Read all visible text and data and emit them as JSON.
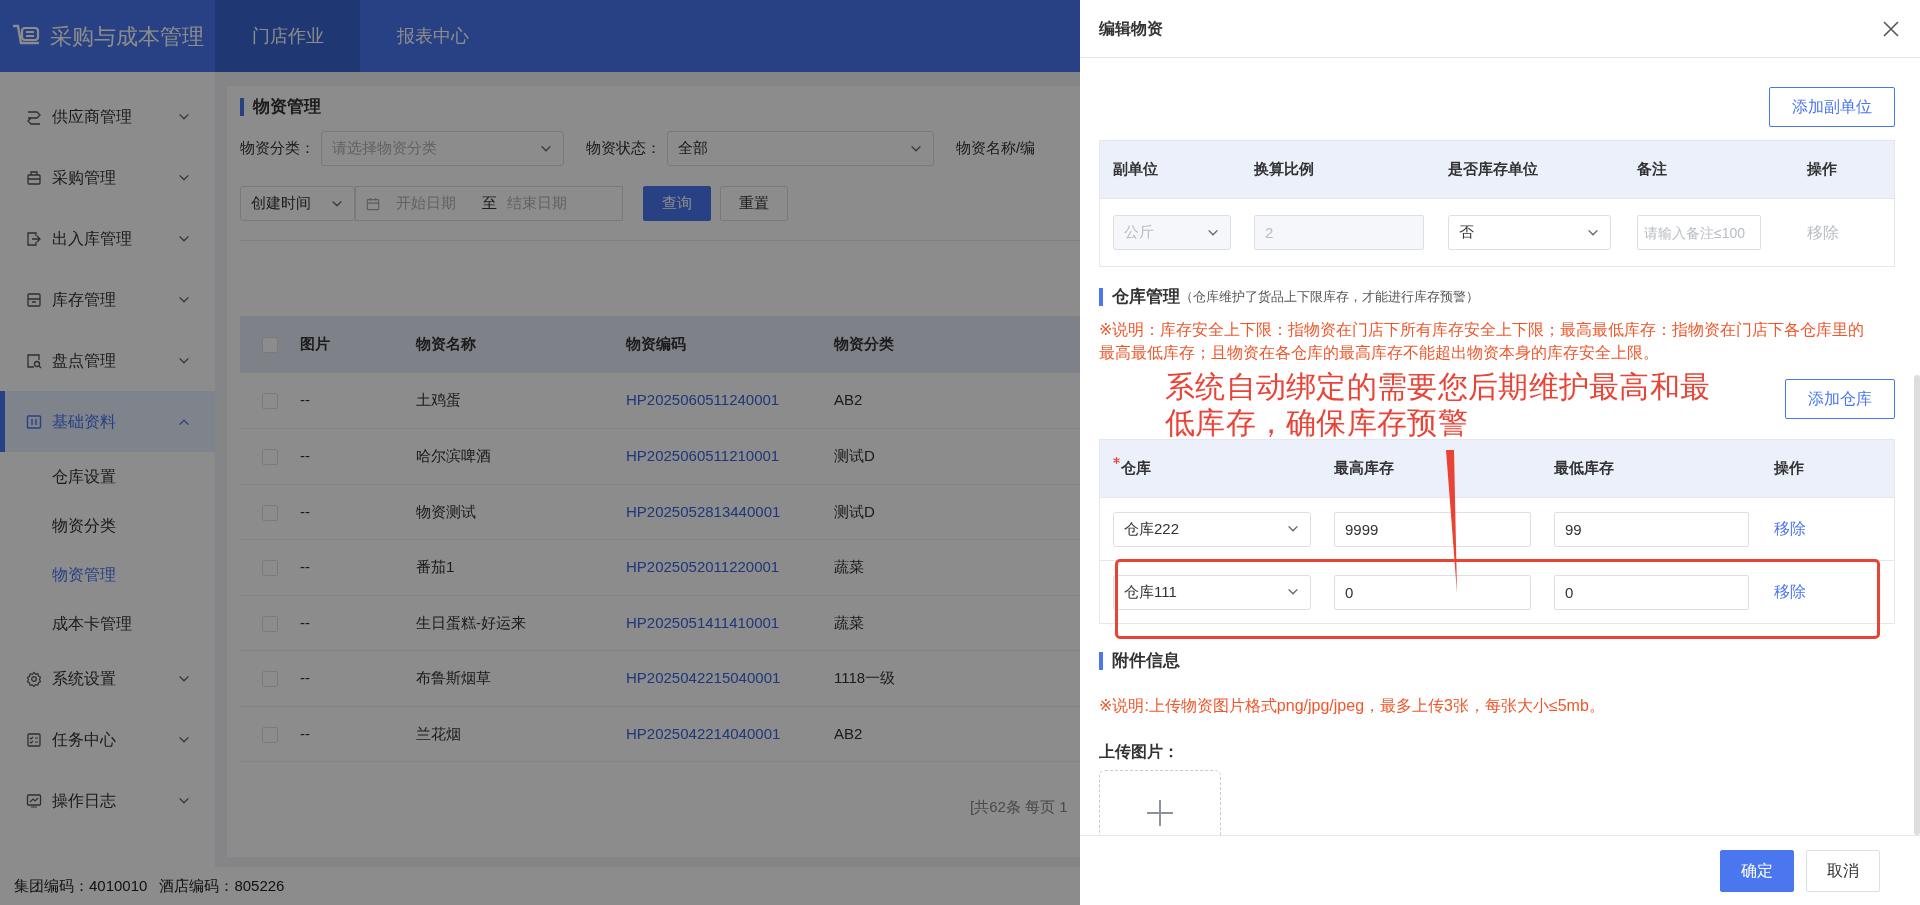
{
  "header": {
    "app_title": "采购与成本管理",
    "tabs": [
      {
        "label": "门店作业",
        "selected": true
      },
      {
        "label": "报表中心",
        "selected": false
      }
    ]
  },
  "sidebar": {
    "items": [
      {
        "label": "供应商管理",
        "expanded": false,
        "selected": false
      },
      {
        "label": "采购管理",
        "expanded": false,
        "selected": false
      },
      {
        "label": "出入库管理",
        "expanded": false,
        "selected": false
      },
      {
        "label": "库存管理",
        "expanded": false,
        "selected": false
      },
      {
        "label": "盘点管理",
        "expanded": false,
        "selected": false
      },
      {
        "label": "基础资料",
        "expanded": true,
        "selected": true,
        "children": [
          {
            "label": "仓库设置",
            "selected": false
          },
          {
            "label": "物资分类",
            "selected": false
          },
          {
            "label": "物资管理",
            "selected": true
          },
          {
            "label": "成本卡管理",
            "selected": false
          }
        ]
      },
      {
        "label": "系统设置",
        "expanded": false,
        "selected": false
      },
      {
        "label": "任务中心",
        "expanded": false,
        "selected": false
      },
      {
        "label": "操作日志",
        "expanded": false,
        "selected": false
      }
    ]
  },
  "page": {
    "title": "物资管理",
    "filters": [
      {
        "label": "物资分类：",
        "placeholder": "请选择物资分类"
      },
      {
        "label": "物资状态：",
        "value": "全部"
      },
      {
        "label": "物资名称/编"
      }
    ],
    "date_filter": {
      "field": "创建时间",
      "start_placeholder": "开始日期",
      "separator": "至",
      "end_placeholder": "结束日期"
    },
    "buttons": [
      {
        "label": "查询",
        "kind": "primary"
      },
      {
        "label": "重置",
        "kind": "default"
      }
    ],
    "table": {
      "all_checked": false,
      "columns": [
        "图片",
        "物资名称",
        "物资编码",
        "物资分类"
      ],
      "rows": [
        {
          "checked": false,
          "image": "--",
          "name": "土鸡蛋",
          "code": "HP2025060511240001",
          "category": "AB2"
        },
        {
          "checked": false,
          "image": "--",
          "name": "哈尔滨啤酒",
          "code": "HP2025060511210001",
          "category": "测试D"
        },
        {
          "checked": false,
          "image": "--",
          "name": "物资测试",
          "code": "HP2025052813440001",
          "category": "测试D"
        },
        {
          "checked": false,
          "image": "--",
          "name": "番茄1",
          "code": "HP2025052011220001",
          "category": "蔬菜"
        },
        {
          "checked": false,
          "image": "--",
          "name": "生日蛋糕-好运来",
          "code": "HP2025051411410001",
          "category": "蔬菜"
        },
        {
          "checked": false,
          "image": "--",
          "name": "布鲁斯烟草",
          "code": "HP2025042215040001",
          "category": "1118一级"
        },
        {
          "checked": false,
          "image": "--",
          "name": "兰花烟",
          "code": "HP2025042214040001",
          "category": "AB2"
        }
      ]
    },
    "pagination": "[共62条 每页 1"
  },
  "status_bar": [
    "集团编码：4010010",
    "酒店编码：805226"
  ],
  "drawer": {
    "title": "编辑物资",
    "add_unit_button": "添加副单位",
    "units_table": {
      "columns": [
        "副单位",
        "换算比例",
        "是否库存单位",
        "备注",
        "操作"
      ],
      "rows": [
        {
          "unit": "公斤",
          "ratio": "2",
          "stock_unit": "否",
          "remark_placeholder": "请输入备注≤100",
          "action": "移除",
          "disabled": true
        }
      ]
    },
    "warehouse_section": {
      "title": "仓库管理",
      "note": "（仓库维护了货品上下限库存，才能进行库存预警）",
      "explanation": "※说明：库存安全上下限：指物资在门店下所有库存安全上下限；最高最低库存：指物资在门店下各仓库里的最高最低库存；且物资在各仓库的最高库存不能超出物资本身的库存安全上限。",
      "annotation": "系统自动绑定的需要您后期维护最高和最低库存，确保库存预警",
      "add_button": "添加仓库",
      "columns": [
        {
          "label": "仓库",
          "required": true
        },
        {
          "label": "最高库存",
          "required": false
        },
        {
          "label": "最低库存",
          "required": false
        },
        {
          "label": "操作",
          "required": false
        }
      ],
      "rows": [
        {
          "warehouse": "仓库222",
          "max": "9999",
          "min": "99",
          "action": "移除",
          "highlighted": false
        },
        {
          "warehouse": "仓库111",
          "max": "0",
          "min": "0",
          "action": "移除",
          "highlighted": true
        }
      ]
    },
    "attachments": {
      "title": "附件信息",
      "note": "※说明:上传物资图片格式png/jpg/jpeg，最多上传3张，每张大小≤5mb。",
      "upload_label": "上传图片："
    },
    "buttons": [
      {
        "label": "确定",
        "kind": "primary"
      },
      {
        "label": "取消",
        "kind": "default"
      }
    ]
  }
}
